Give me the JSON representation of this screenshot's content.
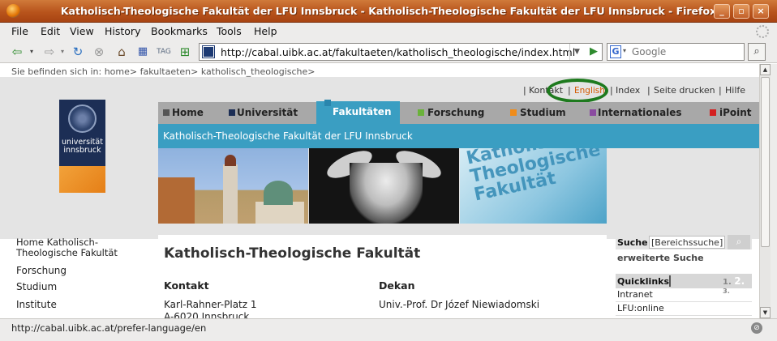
{
  "window": {
    "title": "Katholisch-Theologische Fakultät der LFU Innsbruck - Katholisch-Theologische Fakultät der LFU Innsbruck - Firefox",
    "minimize": "_",
    "maximize": "▫",
    "close": "×"
  },
  "menu": {
    "items": [
      "File",
      "Edit",
      "View",
      "History",
      "Bookmarks",
      "Tools",
      "Help"
    ]
  },
  "toolbar": {
    "back_icon": "back-arrow-icon",
    "url": "http://cabal.uibk.ac.at/fakultaeten/katholisch_theologische/index.html",
    "search_placeholder": "Google",
    "search_engine": "G"
  },
  "page": {
    "breadcrumb": "Sie befinden sich in: home> fakultaeten> katholisch_theologische>",
    "utility_links": [
      {
        "label": "Kontakt"
      },
      {
        "label": "English"
      },
      {
        "label": "Index"
      },
      {
        "label": "Seite drucken"
      },
      {
        "label": "Hilfe"
      }
    ],
    "logo": {
      "line1": "universität",
      "line2": "innsbruck"
    },
    "main_nav": [
      {
        "label": "Home",
        "color": "#555555"
      },
      {
        "label": "Universität",
        "color": "#1c2e55"
      },
      {
        "label": "Fakultäten",
        "color": "#3a9ec2"
      },
      {
        "label": "Forschung",
        "color": "#6ab23a"
      },
      {
        "label": "Studium",
        "color": "#f08c1a"
      },
      {
        "label": "Internationales",
        "color": "#8a4ba0"
      },
      {
        "label": "iPoint",
        "color": "#d42020"
      }
    ],
    "faculty_bar": "Katholisch-Theologische Fakultät der LFU Innsbruck",
    "banner_text": [
      "Katholisch-",
      "Theologische",
      "Fakultät"
    ],
    "left_nav": [
      "Home Katholisch-Theologische Fakultät",
      "Forschung",
      "Studium",
      "Institute"
    ],
    "main_title": "Katholisch-Theologische Fakultät",
    "kontakt": {
      "heading": "Kontakt",
      "line1": "Karl-Rahner-Platz 1",
      "line2": "A-6020 Innsbruck"
    },
    "dekan": {
      "heading": "Dekan",
      "line1": "Univ.-Prof. Dr Józef Niewiadomski"
    },
    "search": {
      "label": "Suche",
      "value": "[Bereichssuche]",
      "button_icon": "magnifier-icon",
      "extended": "erweiterte Suche"
    },
    "quicklinks": {
      "label": "Quicklinks",
      "tabs": [
        "1.",
        "2.",
        "3."
      ],
      "items": [
        "Intranet",
        "LFU:online"
      ]
    }
  },
  "status": {
    "text": "http://cabal.uibk.ac.at/prefer-language/en"
  },
  "colors": {
    "accent": "#3a9ec2",
    "highlight_ellipse": "#1e7a1e",
    "english_link": "#d45a00"
  }
}
